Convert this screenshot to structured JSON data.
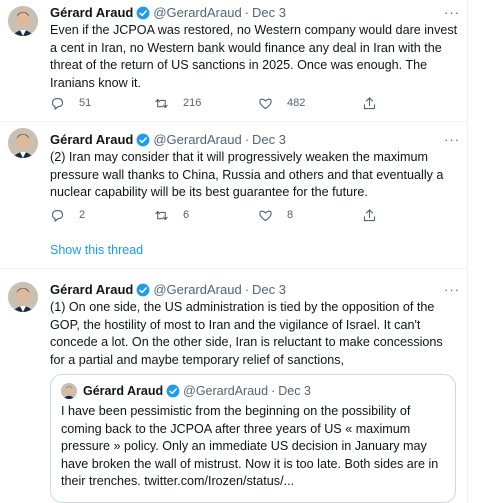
{
  "tweets": [
    {
      "name": "Gérard Araud",
      "handle": "@GerardAraud",
      "date": "Dec 3",
      "text": "Even if the JCPOA was restored, no Western company would dare invest a cent in Iran, no Western bank would finance any deal in Iran with the threat of the return of US sanctions in 2025. Once was enough. The Iranians know it.",
      "replies": "51",
      "retweets": "216",
      "likes": "482"
    },
    {
      "name": "Gérard Araud",
      "handle": "@GerardAraud",
      "date": "Dec 3",
      "text": "(2) Iran may consider that it will progressively weaken the maximum pressure wall thanks to China, Russia and others and that eventually a nuclear capability will be its best guarantee for the future.",
      "replies": "2",
      "retweets": "6",
      "likes": "8"
    },
    {
      "name": "Gérard Araud",
      "handle": "@GerardAraud",
      "date": "Dec 3",
      "text": "(1) On one side, the US administration is tied by the opposition of the GOP, the hostility of most to Iran and the vigilance of Israel. It can't concede a lot. On the other side, Iran is reluctant to make concessions for a partial and maybe temporary relief of sanctions,"
    }
  ],
  "show_thread": "Show this thread",
  "quote": {
    "name": "Gérard Araud",
    "handle": "@GerardAraud",
    "date": "Dec 3",
    "text": "I have been pessimistic from the beginning on the possibility of coming back to the JCPOA after three years of US « maximum pressure » policy. Only an immediate US decision in January may have broken the wall of mistrust. Now it is too late. Both sides are in their trenches. twitter.com/Irozen/status/..."
  },
  "separator_dot": "·",
  "more_glyph": "···",
  "colors": {
    "accent": "#1d9bf0",
    "muted": "#536471",
    "text": "#0f1419",
    "border": "#cfd9de"
  },
  "icons": [
    "verified-badge-icon",
    "reply-icon",
    "retweet-icon",
    "like-icon",
    "share-icon",
    "more-icon"
  ]
}
